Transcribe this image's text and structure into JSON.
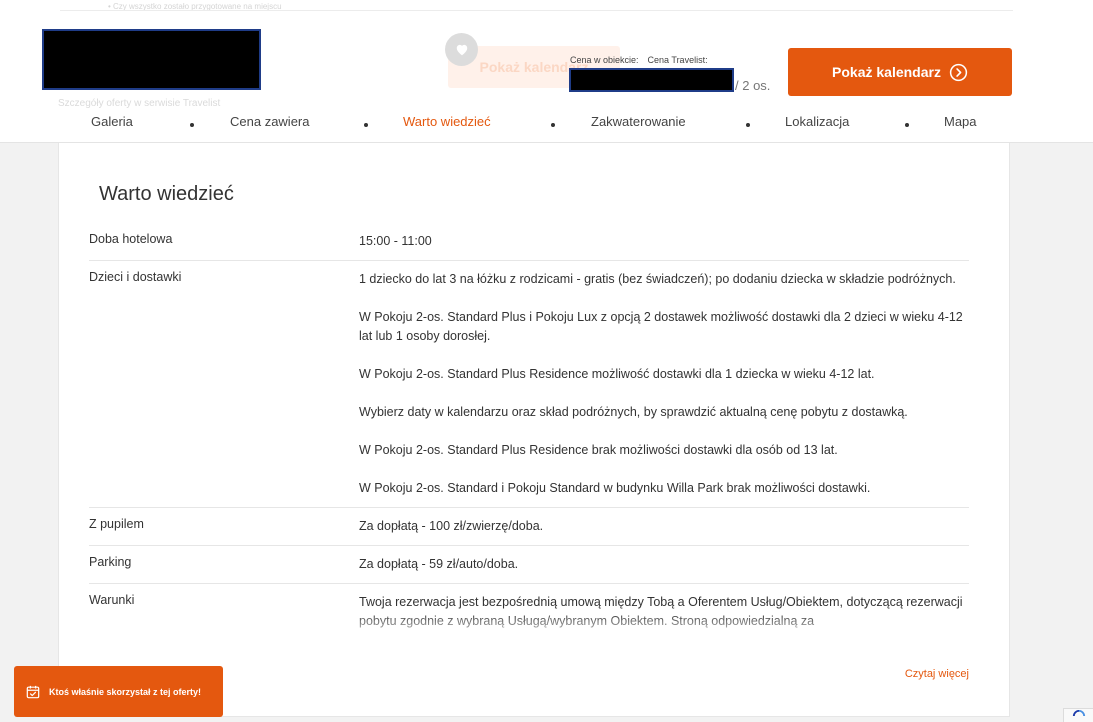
{
  "header": {
    "ghost_top_text": "• Czy wszystko zostało przygotowane na miejscu",
    "ghost_calendar_label": "Pokaż kalendarz",
    "price_label_object": "Cena w obiekcie:",
    "price_label_travelist": "Cena Travelist:",
    "price_per": "/ 2 os.",
    "calendar_button_label": "Pokaż kalendarz",
    "ghost_sub_text": "Szczegóły oferty w serwisie Travelist",
    "accent_color": "#e4580f"
  },
  "nav": {
    "items": [
      {
        "label": "Galeria"
      },
      {
        "label": "Cena zawiera"
      },
      {
        "label": "Warto wiedzieć"
      },
      {
        "label": "Zakwaterowanie"
      },
      {
        "label": "Lokalizacja"
      },
      {
        "label": "Mapa"
      }
    ],
    "active_index": 2
  },
  "section": {
    "title": "Warto wiedzieć",
    "rows": [
      {
        "label": "Doba hotelowa",
        "paragraphs": [
          "15:00 - 11:00"
        ]
      },
      {
        "label": "Dzieci i dostawki",
        "paragraphs": [
          "1 dziecko do lat 3 na łóżku z rodzicami - gratis (bez świadczeń); po dodaniu dziecka w składzie podróżnych.",
          "W Pokoju 2-os. Standard Plus i Pokoju Lux z opcją 2 dostawek możliwość dostawki dla 2 dzieci w wieku 4-12 lat lub 1 osoby dorosłej.",
          "W Pokoju 2-os. Standard Plus Residence możliwość dostawki dla 1 dziecka w wieku 4-12 lat.",
          "Wybierz daty w kalendarzu oraz skład podróżnych, by sprawdzić aktualną cenę pobytu z dostawką.",
          "W Pokoju 2-os. Standard Plus Residence brak możliwości dostawki dla osób od 13 lat.",
          "W Pokoju 2-os. Standard i Pokoju Standard w budynku Willa Park brak możliwości dostawki."
        ]
      },
      {
        "label": "Z pupilem",
        "paragraphs": [
          "Za dopłatą - 100 zł/zwierzę/doba."
        ]
      },
      {
        "label": "Parking",
        "paragraphs": [
          "Za dopłatą - 59 zł/auto/doba."
        ]
      },
      {
        "label": "Warunki",
        "paragraphs": [
          "Twoja rezerwacja jest bezpośrednią umową między Tobą a Oferentem Usług/Obiektem, dotyczącą rezerwacji pobytu zgodnie z wybraną Usługą/wybranym Obiektem. Stroną odpowiedzialną za"
        ]
      }
    ],
    "read_more_label": "Czytaj więcej"
  },
  "toast": {
    "text": "Ktoś właśnie skorzystał z tej oferty!"
  }
}
